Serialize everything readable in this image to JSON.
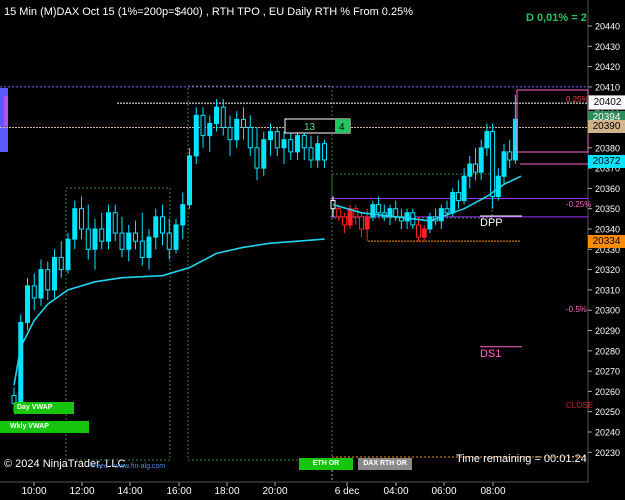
{
  "header": {
    "title": "15 Min (M)DAX Oct 15 (1%=200p=$400) , RTH TPO , EU Daily RTH % From 0.25%",
    "delta": "D 0,01% = 2"
  },
  "axis": {
    "y_ticks": [
      "20410",
      "20400",
      "20390",
      "20380",
      "20370",
      "20360",
      "20350",
      "20340",
      "20330",
      "20320",
      "20310",
      "20300",
      "20290",
      "20280",
      "20270",
      "20260",
      "20250",
      "20240",
      "20230",
      "20440",
      "20430",
      "20420"
    ],
    "x_ticks": [
      "10:00",
      "12:00",
      "14:00",
      "16:00",
      "18:00",
      "20:00",
      "6 dec",
      "04:00",
      "06:00",
      "08:00"
    ]
  },
  "price_boxes": [
    {
      "label": "20402",
      "color": "#ffffff",
      "text": "#000000"
    },
    {
      "label": "20394",
      "color": "#2e8b57",
      "text": "#ffffff"
    },
    {
      "label": "20390",
      "color": "#d2b48c",
      "text": "#000000"
    },
    {
      "label": "20372",
      "color": "#00e5ff",
      "text": "#000000"
    },
    {
      "label": "20334",
      "color": "#ff8c00",
      "text": "#000000"
    }
  ],
  "annotations": {
    "pct_025_top": "0.25%",
    "pct_025_neg": "-0.25%",
    "pct_05_neg": "-0.5%",
    "dpp": "DPP",
    "ds1": "DS1",
    "close": "CLOSE",
    "box_count": "13",
    "box_green": "4"
  },
  "buttons": {
    "day_vwap": "Day VWAP",
    "wkly_vwap": "Wkly VWAP",
    "eth_or": "ETH OR",
    "dax_rth_or": "DAX RTH OR"
  },
  "footer": {
    "copyright": "© 2024 NinjaTrader, LLC",
    "source": "Feed - www.fin-alg.com",
    "time_remaining": "Time remaining = 00:01:24"
  },
  "chart_data": {
    "type": "candlestick",
    "title": "15 Min (M)DAX Oct 15 (1%=200p=$400) , RTH TPO , EU Daily RTH % From 0.25%",
    "ylim": [
      20225,
      20445
    ],
    "x_labels": [
      "10:00",
      "12:00",
      "14:00",
      "16:00",
      "18:00",
      "20:00",
      "6 dec",
      "04:00",
      "06:00",
      "08:00"
    ],
    "candles": [
      {
        "o": 20258,
        "h": 20262,
        "l": 20250,
        "c": 20254,
        "col": "cyan"
      },
      {
        "o": 20254,
        "h": 20298,
        "l": 20252,
        "c": 20294,
        "col": "cyan"
      },
      {
        "o": 20294,
        "h": 20316,
        "l": 20290,
        "c": 20312,
        "col": "cyan"
      },
      {
        "o": 20312,
        "h": 20318,
        "l": 20300,
        "c": 20306,
        "col": "cyan"
      },
      {
        "o": 20306,
        "h": 20325,
        "l": 20302,
        "c": 20320,
        "col": "cyan"
      },
      {
        "o": 20320,
        "h": 20324,
        "l": 20305,
        "c": 20310,
        "col": "cyan"
      },
      {
        "o": 20310,
        "h": 20330,
        "l": 20306,
        "c": 20326,
        "col": "cyan"
      },
      {
        "o": 20326,
        "h": 20334,
        "l": 20316,
        "c": 20320,
        "col": "cyan"
      },
      {
        "o": 20320,
        "h": 20338,
        "l": 20318,
        "c": 20335,
        "col": "cyan"
      },
      {
        "o": 20335,
        "h": 20354,
        "l": 20330,
        "c": 20350,
        "col": "cyan"
      },
      {
        "o": 20350,
        "h": 20356,
        "l": 20335,
        "c": 20340,
        "col": "cyan"
      },
      {
        "o": 20340,
        "h": 20352,
        "l": 20325,
        "c": 20330,
        "col": "cyan"
      },
      {
        "o": 20330,
        "h": 20345,
        "l": 20320,
        "c": 20340,
        "col": "cyan"
      },
      {
        "o": 20340,
        "h": 20348,
        "l": 20330,
        "c": 20334,
        "col": "cyan"
      },
      {
        "o": 20334,
        "h": 20352,
        "l": 20330,
        "c": 20348,
        "col": "cyan"
      },
      {
        "o": 20348,
        "h": 20352,
        "l": 20334,
        "c": 20338,
        "col": "cyan"
      },
      {
        "o": 20338,
        "h": 20346,
        "l": 20326,
        "c": 20330,
        "col": "cyan"
      },
      {
        "o": 20330,
        "h": 20342,
        "l": 20324,
        "c": 20338,
        "col": "cyan"
      },
      {
        "o": 20338,
        "h": 20344,
        "l": 20330,
        "c": 20334,
        "col": "cyan"
      },
      {
        "o": 20334,
        "h": 20348,
        "l": 20322,
        "c": 20326,
        "col": "cyan"
      },
      {
        "o": 20326,
        "h": 20340,
        "l": 20320,
        "c": 20336,
        "col": "cyan"
      },
      {
        "o": 20336,
        "h": 20350,
        "l": 20330,
        "c": 20346,
        "col": "cyan"
      },
      {
        "o": 20346,
        "h": 20352,
        "l": 20332,
        "c": 20338,
        "col": "cyan"
      },
      {
        "o": 20338,
        "h": 20345,
        "l": 20325,
        "c": 20330,
        "col": "cyan"
      },
      {
        "o": 20330,
        "h": 20345,
        "l": 20328,
        "c": 20342,
        "col": "cyan"
      },
      {
        "o": 20342,
        "h": 20358,
        "l": 20335,
        "c": 20352,
        "col": "cyan"
      },
      {
        "o": 20352,
        "h": 20380,
        "l": 20350,
        "c": 20376,
        "col": "cyan"
      },
      {
        "o": 20376,
        "h": 20400,
        "l": 20372,
        "c": 20396,
        "col": "cyan"
      },
      {
        "o": 20396,
        "h": 20400,
        "l": 20380,
        "c": 20386,
        "col": "cyan"
      },
      {
        "o": 20386,
        "h": 20396,
        "l": 20378,
        "c": 20392,
        "col": "cyan"
      },
      {
        "o": 20392,
        "h": 20404,
        "l": 20388,
        "c": 20400,
        "col": "cyan"
      },
      {
        "o": 20400,
        "h": 20404,
        "l": 20386,
        "c": 20390,
        "col": "cyan"
      },
      {
        "o": 20390,
        "h": 20396,
        "l": 20376,
        "c": 20384,
        "col": "cyan"
      },
      {
        "o": 20384,
        "h": 20398,
        "l": 20380,
        "c": 20394,
        "col": "cyan"
      },
      {
        "o": 20394,
        "h": 20400,
        "l": 20384,
        "c": 20390,
        "col": "cyan"
      },
      {
        "o": 20390,
        "h": 20396,
        "l": 20376,
        "c": 20380,
        "col": "cyan"
      },
      {
        "o": 20380,
        "h": 20390,
        "l": 20364,
        "c": 20370,
        "col": "cyan"
      },
      {
        "o": 20370,
        "h": 20388,
        "l": 20366,
        "c": 20384,
        "col": "cyan"
      },
      {
        "o": 20384,
        "h": 20392,
        "l": 20376,
        "c": 20388,
        "col": "cyan"
      },
      {
        "o": 20388,
        "h": 20390,
        "l": 20376,
        "c": 20380,
        "col": "cyan"
      },
      {
        "o": 20380,
        "h": 20388,
        "l": 20372,
        "c": 20384,
        "col": "cyan"
      },
      {
        "o": 20384,
        "h": 20388,
        "l": 20374,
        "c": 20378,
        "col": "cyan"
      },
      {
        "o": 20378,
        "h": 20390,
        "l": 20374,
        "c": 20386,
        "col": "cyan"
      },
      {
        "o": 20386,
        "h": 20388,
        "l": 20374,
        "c": 20380,
        "col": "cyan"
      },
      {
        "o": 20380,
        "h": 20386,
        "l": 20370,
        "c": 20374,
        "col": "cyan"
      },
      {
        "o": 20374,
        "h": 20386,
        "l": 20370,
        "c": 20382,
        "col": "cyan"
      },
      {
        "o": 20382,
        "h": 20384,
        "l": 20370,
        "c": 20374,
        "col": "cyan"
      },
      {
        "o": 20354,
        "h": 20356,
        "l": 20346,
        "c": 20350,
        "col": "white"
      },
      {
        "o": 20350,
        "h": 20352,
        "l": 20344,
        "c": 20346,
        "col": "red"
      },
      {
        "o": 20346,
        "h": 20348,
        "l": 20338,
        "c": 20342,
        "col": "red"
      },
      {
        "o": 20342,
        "h": 20352,
        "l": 20340,
        "c": 20350,
        "col": "red"
      },
      {
        "o": 20350,
        "h": 20352,
        "l": 20342,
        "c": 20346,
        "col": "red"
      },
      {
        "o": 20346,
        "h": 20348,
        "l": 20336,
        "c": 20340,
        "col": "red"
      },
      {
        "o": 20340,
        "h": 20350,
        "l": 20334,
        "c": 20346,
        "col": "red"
      },
      {
        "o": 20346,
        "h": 20354,
        "l": 20344,
        "c": 20352,
        "col": "cyan"
      },
      {
        "o": 20352,
        "h": 20356,
        "l": 20346,
        "c": 20348,
        "col": "cyan"
      },
      {
        "o": 20348,
        "h": 20352,
        "l": 20344,
        "c": 20346,
        "col": "cyan"
      },
      {
        "o": 20346,
        "h": 20352,
        "l": 20342,
        "c": 20350,
        "col": "cyan"
      },
      {
        "o": 20350,
        "h": 20354,
        "l": 20344,
        "c": 20346,
        "col": "cyan"
      },
      {
        "o": 20346,
        "h": 20350,
        "l": 20340,
        "c": 20344,
        "col": "cyan"
      },
      {
        "o": 20344,
        "h": 20350,
        "l": 20340,
        "c": 20348,
        "col": "cyan"
      },
      {
        "o": 20348,
        "h": 20350,
        "l": 20340,
        "c": 20342,
        "col": "cyan"
      },
      {
        "o": 20342,
        "h": 20346,
        "l": 20334,
        "c": 20336,
        "col": "red"
      },
      {
        "o": 20336,
        "h": 20342,
        "l": 20334,
        "c": 20340,
        "col": "red"
      },
      {
        "o": 20340,
        "h": 20348,
        "l": 20338,
        "c": 20346,
        "col": "cyan"
      },
      {
        "o": 20346,
        "h": 20350,
        "l": 20342,
        "c": 20344,
        "col": "cyan"
      },
      {
        "o": 20344,
        "h": 20352,
        "l": 20340,
        "c": 20350,
        "col": "cyan"
      },
      {
        "o": 20350,
        "h": 20354,
        "l": 20346,
        "c": 20348,
        "col": "cyan"
      },
      {
        "o": 20348,
        "h": 20360,
        "l": 20346,
        "c": 20358,
        "col": "cyan"
      },
      {
        "o": 20358,
        "h": 20364,
        "l": 20350,
        "c": 20354,
        "col": "cyan"
      },
      {
        "o": 20354,
        "h": 20370,
        "l": 20352,
        "c": 20366,
        "col": "cyan"
      },
      {
        "o": 20366,
        "h": 20376,
        "l": 20360,
        "c": 20372,
        "col": "cyan"
      },
      {
        "o": 20372,
        "h": 20380,
        "l": 20364,
        "c": 20368,
        "col": "cyan"
      },
      {
        "o": 20368,
        "h": 20384,
        "l": 20364,
        "c": 20380,
        "col": "cyan"
      },
      {
        "o": 20380,
        "h": 20392,
        "l": 20376,
        "c": 20388,
        "col": "cyan"
      },
      {
        "o": 20388,
        "h": 20392,
        "l": 20350,
        "c": 20356,
        "col": "cyan"
      },
      {
        "o": 20356,
        "h": 20370,
        "l": 20354,
        "c": 20366,
        "col": "cyan"
      },
      {
        "o": 20366,
        "h": 20382,
        "l": 20362,
        "c": 20378,
        "col": "cyan"
      },
      {
        "o": 20378,
        "h": 20384,
        "l": 20370,
        "c": 20374,
        "col": "cyan"
      },
      {
        "o": 20374,
        "h": 20406,
        "l": 20372,
        "c": 20394,
        "col": "cyan"
      }
    ],
    "day_vwap": [
      [
        0,
        20263
      ],
      [
        1,
        20282
      ],
      [
        3,
        20295
      ],
      [
        5,
        20303
      ],
      [
        8,
        20310
      ],
      [
        12,
        20314
      ],
      [
        16,
        20316
      ],
      [
        22,
        20317
      ],
      [
        26,
        20321
      ],
      [
        30,
        20328
      ],
      [
        34,
        20331
      ],
      [
        38,
        20333
      ],
      [
        42,
        20334
      ],
      [
        46,
        20335
      ]
    ],
    "eth_vwap": [
      [
        47,
        20352
      ],
      [
        52,
        20348
      ],
      [
        58,
        20346
      ],
      [
        64,
        20344
      ],
      [
        70,
        20350
      ],
      [
        74,
        20356
      ],
      [
        77,
        20362
      ],
      [
        80,
        20366
      ]
    ],
    "hlines": [
      {
        "y": 20410,
        "color": "#8a5cff",
        "dash": "2,2",
        "x0": 0,
        "x1": 588
      },
      {
        "y": 20402,
        "color": "#ffffff",
        "dash": "2,1",
        "x0": 117,
        "x1": 588
      },
      {
        "y": 20390,
        "color": "#d2b48c",
        "dash": "2,1",
        "x0": 0,
        "x1": 588
      },
      {
        "y": 20372,
        "color": "#ff66cc",
        "dash": "",
        "x0": 520,
        "x1": 588
      },
      {
        "y": 20355,
        "color": "#9b30ff",
        "dash": "",
        "x0": 330,
        "x1": 588
      },
      {
        "y": 20346,
        "color": "#9b30ff",
        "dash": "",
        "x0": 330,
        "x1": 588
      },
      {
        "y": 20334,
        "color": "#ff8c00",
        "dash": "2,1",
        "x0": 368,
        "x1": 520
      },
      {
        "y": 20282,
        "color": "#ff66cc",
        "dash": "",
        "x0": 480,
        "x1": 522
      }
    ]
  }
}
